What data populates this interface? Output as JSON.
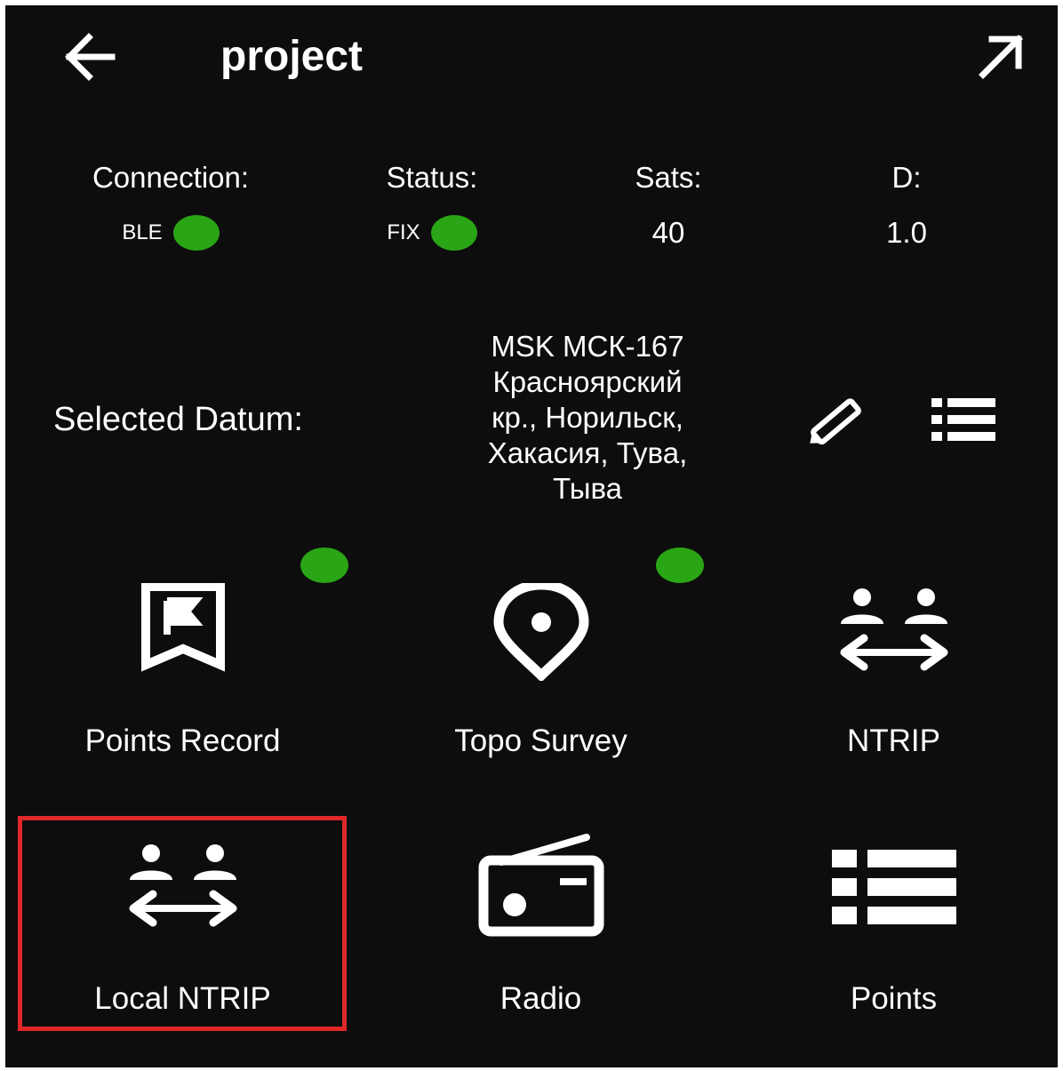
{
  "header": {
    "title": "project",
    "back_icon": "arrow-left-icon",
    "expand_icon": "arrow-up-right-icon"
  },
  "status": {
    "connection": {
      "label": "Connection:",
      "value": "BLE",
      "indicator_color": "#2aa515"
    },
    "status": {
      "label": "Status:",
      "value": "FIX",
      "indicator_color": "#2aa515"
    },
    "sats": {
      "label": "Sats:",
      "value": "40"
    },
    "d": {
      "label": "D:",
      "value": "1.0"
    }
  },
  "datum": {
    "label": "Selected Datum:",
    "value_lines": [
      "MSK МСК-167",
      "Красноярский",
      "кр., Норильск,",
      "Хакасия, Тува,",
      "Тыва"
    ],
    "edit_icon": "pencil-icon",
    "list_icon": "list-icon"
  },
  "tiles": [
    {
      "label": "Points Record",
      "icon": "bookmark-flag-icon",
      "indicator": true
    },
    {
      "label": "Topo Survey",
      "icon": "map-pin-icon",
      "indicator": true
    },
    {
      "label": "NTRIP",
      "icon": "users-transfer-icon",
      "indicator": false
    },
    {
      "label": "Local NTRIP",
      "icon": "users-transfer-icon",
      "indicator": false,
      "highlighted": true
    },
    {
      "label": "Radio",
      "icon": "radio-icon",
      "indicator": false
    },
    {
      "label": "Points",
      "icon": "list-icon",
      "indicator": false
    }
  ],
  "colors": {
    "background": "#0d0d0d",
    "text": "#ffffff",
    "indicator": "#2aa515",
    "highlight": "#e0282a"
  }
}
